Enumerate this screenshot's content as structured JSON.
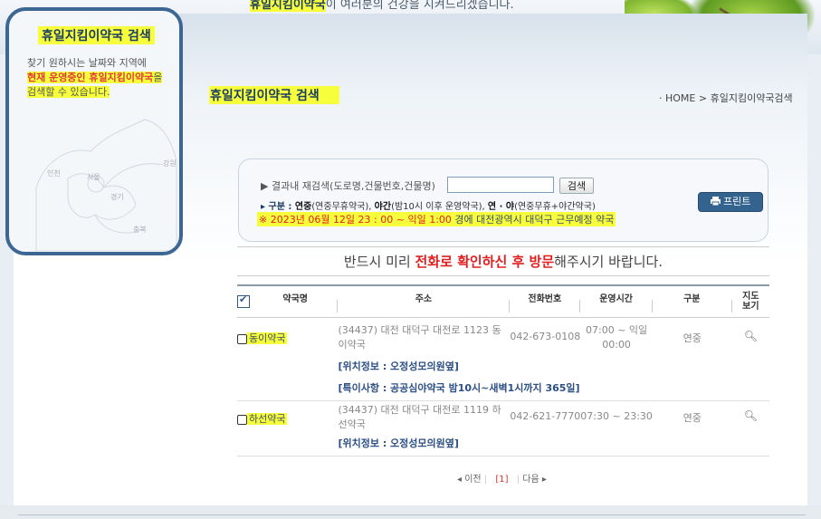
{
  "header": {
    "slogan_highlight": "휴일지킴이약국",
    "slogan_rest": "이 여러분의 건강을 지켜드리겠습니다."
  },
  "sidebar": {
    "title": "휴일지킴이약국 검색",
    "desc_line1": "찾기 원하시는 날짜와 지역에",
    "desc_red": "현재 운영중인 휴일지킴이약국",
    "desc_tail": "을",
    "desc_line3": "검색할 수 있습니다.",
    "map_labels": [
      "인천",
      "서울",
      "강원",
      "경기",
      "충북"
    ]
  },
  "main": {
    "title": "휴일지킴이약국 검색",
    "breadcrumb": {
      "bullet": "·",
      "home": "HOME",
      "sep": ">",
      "current": "휴일지킴이약국검색"
    }
  },
  "search": {
    "label": "▶ 결과내 재검색(도로명,건물번호,건물명)",
    "input_value": "",
    "button_label": "검색",
    "print_label": "프린트",
    "legend": {
      "prefix": "▸ 구분 : ",
      "k1": "연중",
      "d1": "(연중무휴약국), ",
      "k2": "야간",
      "d2": "(밤10시 이후 운영약국), ",
      "k3": "연 · 야",
      "d3": "(연중무휴+야간약국)"
    },
    "notice": {
      "red": "※ 2023년 06월 12일 23 : 00 ~ 익일 1:00",
      "rest": " 경에  대전광역시  대덕구   근무예정 약국"
    }
  },
  "warning": {
    "pre": "반드시 미리 ",
    "red": "전화로 확인하신 후 방문",
    "post": "해주시기 바랍니다."
  },
  "table": {
    "headers": {
      "name": "약국명",
      "address": "주소",
      "phone": "전화번호",
      "hours": "운영시간",
      "type": "구분",
      "map1": "지도",
      "map2": "보기"
    },
    "rows": [
      {
        "name": "동이약국",
        "address": "(34437) 대전 대덕구 대전로 1123 동이약국",
        "phone": "042-673-0108",
        "hours": "07:00 ~ 익일 00:00",
        "type": "연중",
        "location": "[위치정보 : 오정성모의원옆]",
        "special": "[특이사항 : 공공심야약국 밤10시~새벽1시까지 365일]"
      },
      {
        "name": "하선약국",
        "address": "(34437) 대전 대덕구 대전로 1119 하선약국",
        "phone": "042-621-7770",
        "hours": "07:30 ~ 23:30",
        "type": "연중",
        "location": "[위치정보 : 오정성모의원옆]"
      }
    ]
  },
  "pager": {
    "prev": "◂ 이전",
    "current": "[1]",
    "next": "다음 ▸"
  },
  "colors": {
    "highlight": "#f7ff3c",
    "navy": "#1c3d64",
    "red": "#e02020",
    "print": "#35638f",
    "side_border": "#3d6793"
  },
  "icons": [
    "magnifier-icon",
    "printer-icon",
    "checkbox-icon"
  ]
}
